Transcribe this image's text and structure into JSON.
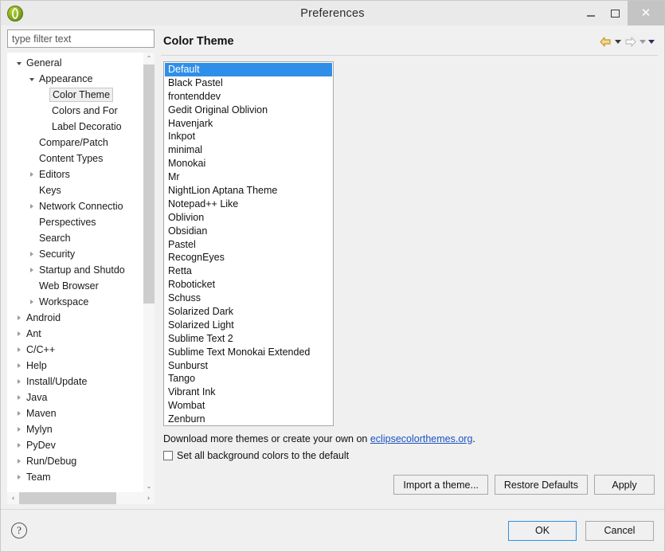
{
  "window": {
    "title": "Preferences",
    "app_icon": "eclipse-icon",
    "controls": {
      "minimize": "minimize-icon",
      "maximize": "maximize-icon",
      "close": "✕"
    }
  },
  "sidebar": {
    "filter": {
      "placeholder": "type filter text",
      "value": ""
    },
    "tree": [
      {
        "label": "General",
        "indent": 0,
        "twisty": "open",
        "selected": false
      },
      {
        "label": "Appearance",
        "indent": 1,
        "twisty": "open",
        "selected": false
      },
      {
        "label": "Color Theme",
        "indent": 2,
        "twisty": "none",
        "selected": true
      },
      {
        "label": "Colors and For",
        "indent": 2,
        "twisty": "none",
        "selected": false
      },
      {
        "label": "Label Decoratio",
        "indent": 2,
        "twisty": "none",
        "selected": false
      },
      {
        "label": "Compare/Patch",
        "indent": 1,
        "twisty": "none",
        "selected": false
      },
      {
        "label": "Content Types",
        "indent": 1,
        "twisty": "none",
        "selected": false
      },
      {
        "label": "Editors",
        "indent": 1,
        "twisty": "closed",
        "selected": false
      },
      {
        "label": "Keys",
        "indent": 1,
        "twisty": "none",
        "selected": false
      },
      {
        "label": "Network Connectio",
        "indent": 1,
        "twisty": "closed",
        "selected": false
      },
      {
        "label": "Perspectives",
        "indent": 1,
        "twisty": "none",
        "selected": false
      },
      {
        "label": "Search",
        "indent": 1,
        "twisty": "none",
        "selected": false
      },
      {
        "label": "Security",
        "indent": 1,
        "twisty": "closed",
        "selected": false
      },
      {
        "label": "Startup and Shutdo",
        "indent": 1,
        "twisty": "closed",
        "selected": false
      },
      {
        "label": "Web Browser",
        "indent": 1,
        "twisty": "none",
        "selected": false
      },
      {
        "label": "Workspace",
        "indent": 1,
        "twisty": "closed",
        "selected": false
      },
      {
        "label": "Android",
        "indent": 0,
        "twisty": "closed",
        "selected": false
      },
      {
        "label": "Ant",
        "indent": 0,
        "twisty": "closed",
        "selected": false
      },
      {
        "label": "C/C++",
        "indent": 0,
        "twisty": "closed",
        "selected": false
      },
      {
        "label": "Help",
        "indent": 0,
        "twisty": "closed",
        "selected": false
      },
      {
        "label": "Install/Update",
        "indent": 0,
        "twisty": "closed",
        "selected": false
      },
      {
        "label": "Java",
        "indent": 0,
        "twisty": "closed",
        "selected": false
      },
      {
        "label": "Maven",
        "indent": 0,
        "twisty": "closed",
        "selected": false
      },
      {
        "label": "Mylyn",
        "indent": 0,
        "twisty": "closed",
        "selected": false
      },
      {
        "label": "PyDev",
        "indent": 0,
        "twisty": "closed",
        "selected": false
      },
      {
        "label": "Run/Debug",
        "indent": 0,
        "twisty": "closed",
        "selected": false
      },
      {
        "label": "Team",
        "indent": 0,
        "twisty": "closed",
        "selected": false
      }
    ],
    "scroll_up_glyph": "⌃",
    "scroll_down_glyph": "⌄",
    "scroll_left_glyph": "‹",
    "scroll_right_glyph": "›"
  },
  "page": {
    "title": "Color Theme",
    "nav": {
      "back": "back-arrow-icon",
      "back_menu": "chevron-down-icon",
      "forward": "forward-arrow-icon",
      "forward_menu": "chevron-down-icon",
      "view_menu": "chevron-down-icon"
    },
    "themes": [
      "Default",
      "Black Pastel",
      "frontenddev",
      "Gedit Original Oblivion",
      "Havenjark",
      "Inkpot",
      "minimal",
      "Monokai",
      "Mr",
      "NightLion Aptana Theme",
      "Notepad++ Like",
      "Oblivion",
      "Obsidian",
      "Pastel",
      "RecognEyes",
      "Retta",
      "Roboticket",
      "Schuss",
      "Solarized Dark",
      "Solarized Light",
      "Sublime Text 2",
      "Sublime Text Monokai Extended",
      "Sunburst",
      "Tango",
      "Vibrant Ink",
      "Wombat",
      "Zenburn"
    ],
    "selected_theme": "Default",
    "download_text_before": "Download more themes or create your own on ",
    "download_link": "eclipsecolorthemes.org",
    "download_text_after": ".",
    "checkbox": {
      "label": "Set all background colors to the default",
      "checked": false
    },
    "buttons": {
      "import": "Import a theme...",
      "restore": "Restore Defaults",
      "apply": "Apply"
    }
  },
  "footer": {
    "help": "?",
    "ok": "OK",
    "cancel": "Cancel"
  },
  "colors": {
    "selection_blue": "#2f8fe8",
    "link_blue": "#1a52c4",
    "titlebar": "#eaeaea",
    "dialog_bg": "#f0f0f0",
    "back_arrow_gold": "#e3b33a",
    "forward_arrow_gray": "#cfcfcf"
  }
}
